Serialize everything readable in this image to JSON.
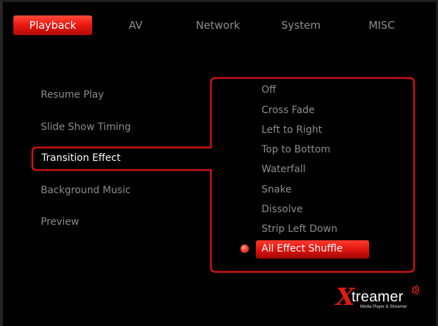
{
  "tabs": [
    {
      "label": "Playback",
      "active": true
    },
    {
      "label": "AV",
      "active": false
    },
    {
      "label": "Network",
      "active": false
    },
    {
      "label": "System",
      "active": false
    },
    {
      "label": "MISC",
      "active": false
    }
  ],
  "menu": {
    "items": [
      {
        "label": "Resume Play"
      },
      {
        "label": "Slide Show Timing"
      },
      {
        "label": "Transition Effect",
        "selected": true
      },
      {
        "label": "Background Music"
      },
      {
        "label": "Preview"
      }
    ]
  },
  "options": {
    "items": [
      {
        "label": "Off"
      },
      {
        "label": "Cross Fade"
      },
      {
        "label": "Left to Right"
      },
      {
        "label": "Top to Bottom"
      },
      {
        "label": "Waterfall"
      },
      {
        "label": "Snake"
      },
      {
        "label": "Dissolve"
      },
      {
        "label": "Strip Left Down"
      },
      {
        "label": "All Effect Shuffle",
        "selected": true
      }
    ]
  },
  "logo": {
    "x_letter": "X",
    "word": "treamer",
    "tagline": "Media Player & Streamer"
  },
  "colors": {
    "accent": "#e8150e",
    "text_inactive": "#8d8d8d",
    "text_active": "#ffffff",
    "background": "#000000"
  }
}
